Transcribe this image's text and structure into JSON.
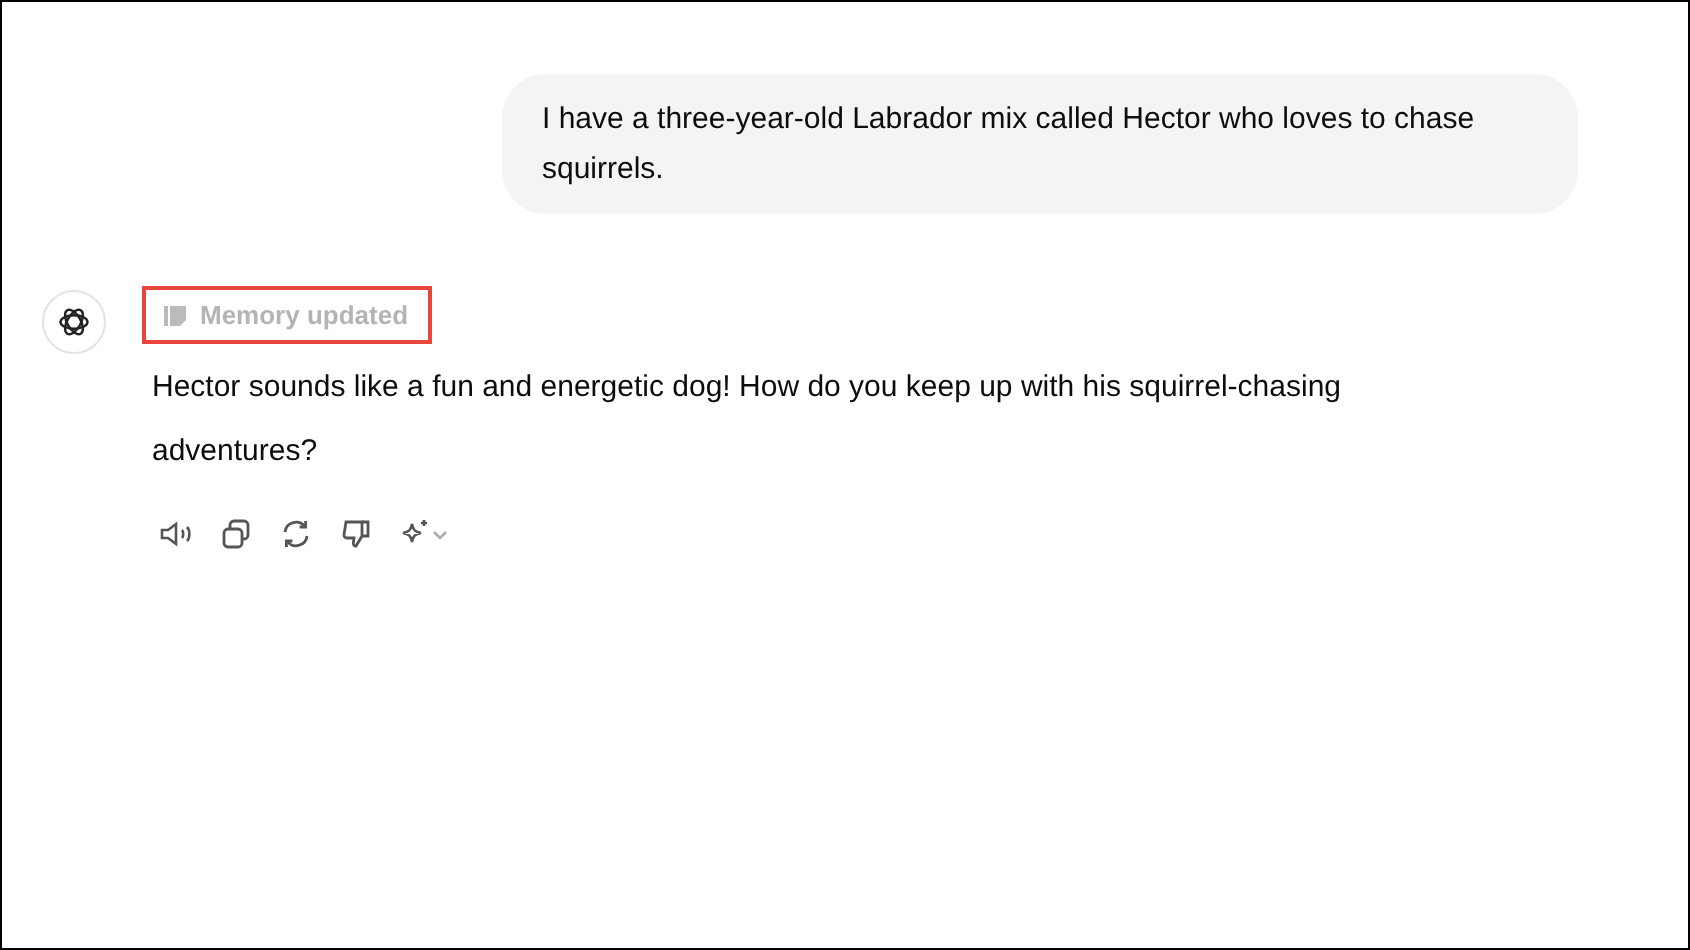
{
  "user_message": {
    "text": "I have a three-year-old Labrador mix called Hector who loves to chase squirrels."
  },
  "assistant_message": {
    "memory_status": {
      "label": "Memory updated",
      "highlighted": true
    },
    "text": "Hector sounds like a fun and energetic dog! How do you keep up with his squirrel-chasing adventures?"
  },
  "actions": [
    {
      "kind": "speaker"
    },
    {
      "kind": "copy"
    },
    {
      "kind": "regenerate"
    },
    {
      "kind": "dislike"
    },
    {
      "kind": "sparkle"
    }
  ]
}
